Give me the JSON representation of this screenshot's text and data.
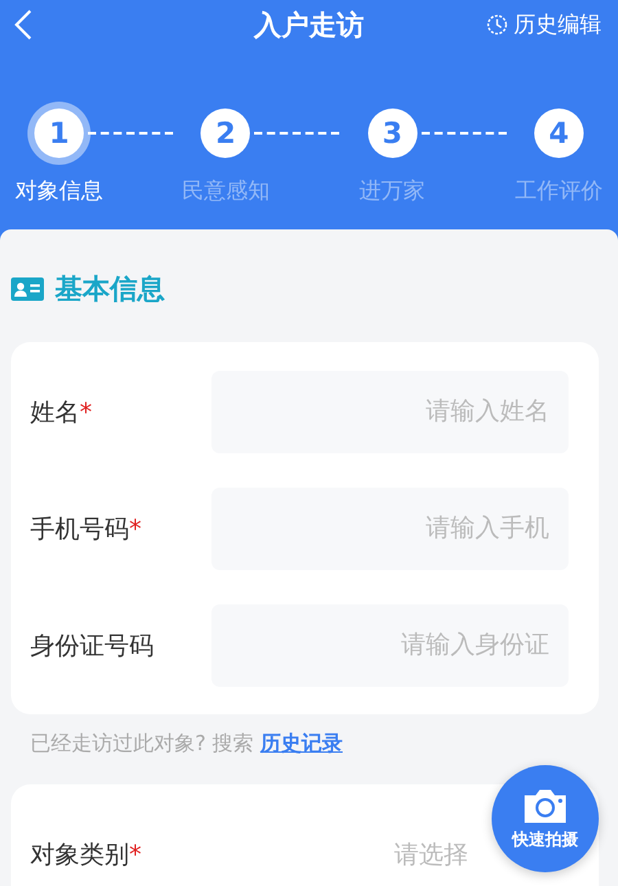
{
  "header": {
    "title": "入户走访",
    "history_edit": "历史编辑"
  },
  "steps": [
    {
      "number": "1",
      "label": "对象信息",
      "selected": true
    },
    {
      "number": "2",
      "label": "民意感知",
      "selected": false
    },
    {
      "number": "3",
      "label": "进万家",
      "selected": false
    },
    {
      "number": "4",
      "label": "工作评价",
      "selected": false
    }
  ],
  "section": {
    "title": "基本信息"
  },
  "basic_fields": [
    {
      "label": "姓名",
      "required_mark": "*",
      "placeholder": "请输入姓名"
    },
    {
      "label": "手机号码",
      "required_mark": "*",
      "placeholder": "请输入手机"
    },
    {
      "label": "身份证号码",
      "placeholder": "请输入身份证"
    }
  ],
  "hint": {
    "text": "已经走访过此对象? 搜索",
    "link": "历史记录"
  },
  "category_fields": [
    {
      "label": "对象类别",
      "required_mark": "*",
      "placeholder": "请选择"
    }
  ],
  "fab": {
    "label": "快速拍摄"
  }
}
